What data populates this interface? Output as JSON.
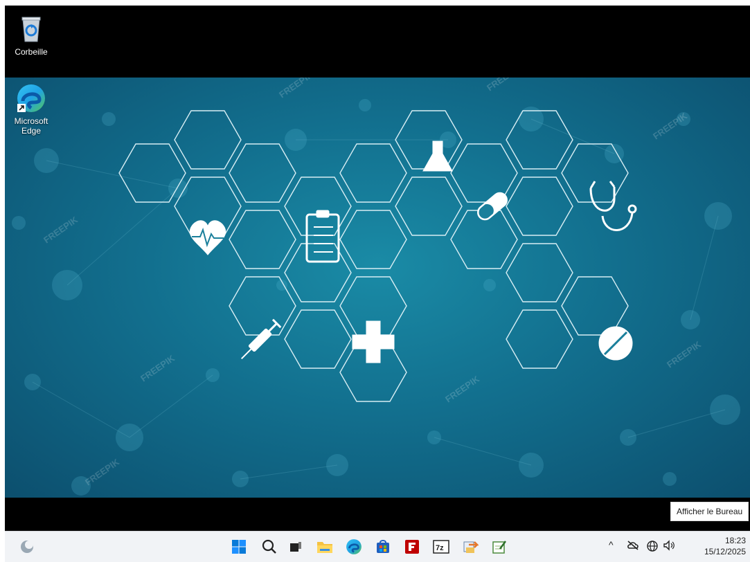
{
  "desktop": {
    "icons": [
      {
        "label": "Corbeille",
        "icon": "recycle-bin-icon"
      },
      {
        "label": "Microsoft Edge",
        "icon": "edge-icon"
      }
    ],
    "wallpaper_watermark": "FREEPIK",
    "colors": {
      "wallpaper_center": "#1a8ba6",
      "wallpaper_edge": "#0c4f6e",
      "hex_line": "#d8eef4"
    }
  },
  "tooltip": {
    "text": "Afficher le Bureau"
  },
  "taskbar": {
    "widgets_icon": "weather-widget-icon",
    "apps": [
      {
        "name": "start",
        "icon": "windows-start-icon"
      },
      {
        "name": "search",
        "icon": "search-icon"
      },
      {
        "name": "task-view",
        "icon": "task-view-icon"
      },
      {
        "name": "file-explorer",
        "icon": "folder-icon"
      },
      {
        "name": "edge",
        "icon": "edge-icon"
      },
      {
        "name": "store",
        "icon": "store-icon"
      },
      {
        "name": "filezilla",
        "icon": "filezilla-icon"
      },
      {
        "name": "7zip",
        "icon": "7zip-icon",
        "text": "7z"
      },
      {
        "name": "app-share",
        "icon": "share-icon"
      },
      {
        "name": "notepad",
        "icon": "notepad-icon"
      }
    ],
    "tray": {
      "chevron": "^",
      "icons": [
        "cloud-off-icon",
        "network-icon",
        "volume-icon"
      ]
    },
    "clock": {
      "time": "18:23",
      "date": "15/12/2025"
    }
  }
}
